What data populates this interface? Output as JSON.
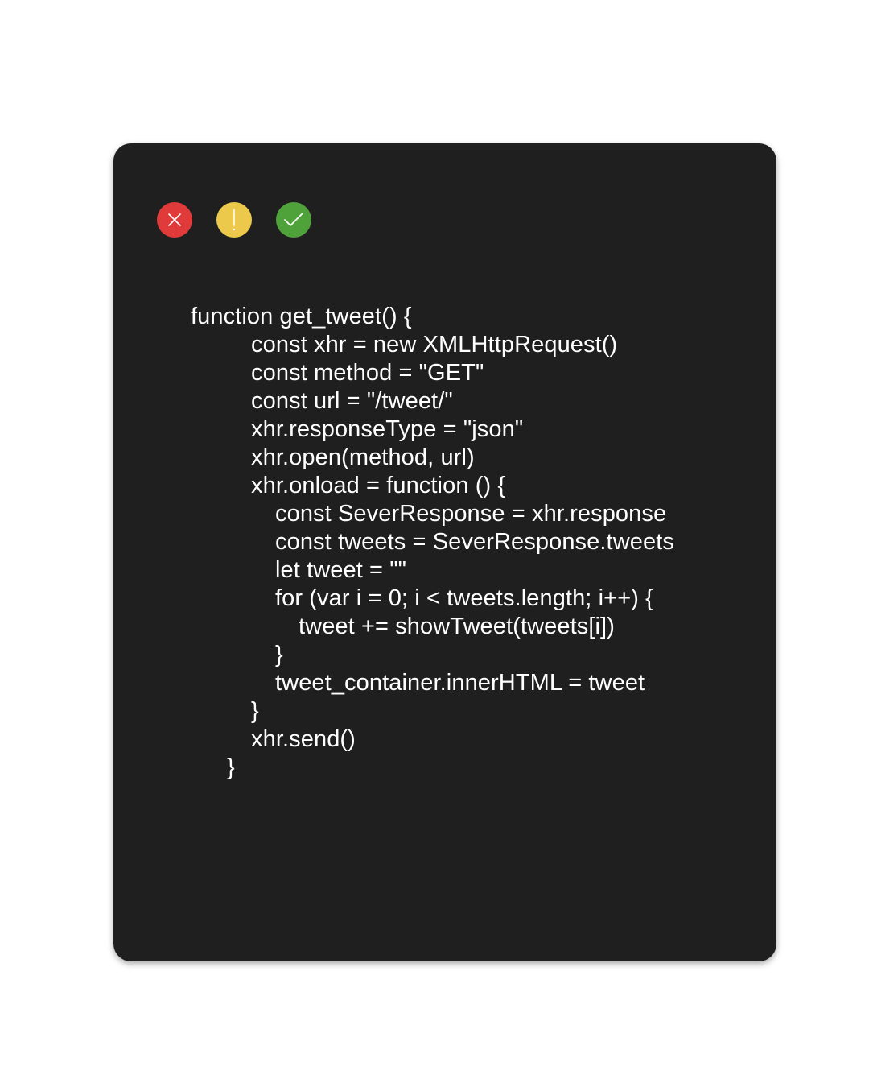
{
  "window": {
    "controls": [
      {
        "name": "close",
        "icon": "close-icon",
        "color": "#e03a3a"
      },
      {
        "name": "warning",
        "icon": "exclamation-icon",
        "color": "#ecc94b"
      },
      {
        "name": "confirm",
        "icon": "checkmark-icon",
        "color": "#4fa23a"
      }
    ],
    "background": "#1f1f1f"
  },
  "code": {
    "lines": [
      {
        "indent": 0,
        "text": "function get_tweet() {"
      },
      {
        "indent": 1,
        "text": "const xhr = new XMLHttpRequest()"
      },
      {
        "indent": 1,
        "text": "const method = \"GET\""
      },
      {
        "indent": 1,
        "text": "const url = \"/tweet/\""
      },
      {
        "indent": 1,
        "text": "xhr.responseType = \"json\""
      },
      {
        "indent": 1,
        "text": "xhr.open(method, url)"
      },
      {
        "indent": 1,
        "text": "xhr.onload = function () {"
      },
      {
        "indent": 2,
        "text": "const SeverResponse = xhr.response"
      },
      {
        "indent": 2,
        "text": "const tweets = SeverResponse.tweets"
      },
      {
        "indent": 2,
        "text": "let tweet = \"\""
      },
      {
        "indent": 2,
        "text": "for (var i = 0; i < tweets.length; i++) {"
      },
      {
        "indent": 3,
        "text": "tweet += showTweet(tweets[i])"
      },
      {
        "indent": 2,
        "text": "}"
      },
      {
        "indent": 2,
        "text": "tweet_container.innerHTML = tweet"
      },
      {
        "indent": 1,
        "text": "}"
      },
      {
        "indent": 1,
        "text": "xhr.send()"
      },
      {
        "indent": 4,
        "text": "}"
      }
    ]
  }
}
